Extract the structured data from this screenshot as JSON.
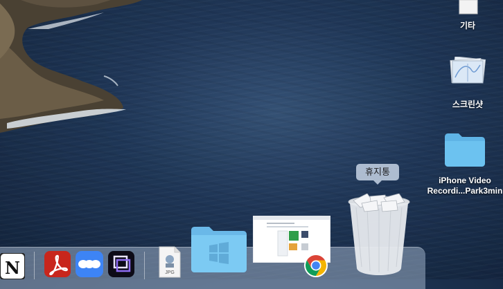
{
  "desktop": {
    "icons": [
      {
        "label": "기타"
      },
      {
        "label": "스크린샷"
      },
      {
        "label_line1": "iPhone Video",
        "label_line2": "Recordi...Park3min"
      }
    ]
  },
  "dock": {
    "apps": [
      {
        "name": "Notion",
        "icon": "notion-icon"
      },
      {
        "name": "Acrobat",
        "icon": "acrobat-icon"
      },
      {
        "name": "More",
        "icon": "more-dots-icon"
      },
      {
        "name": "Screen app",
        "icon": "overlap-squares-icon"
      },
      {
        "name": "JPG file",
        "icon": "jpg-file-icon",
        "badge": "JPG"
      },
      {
        "name": "Windows folder",
        "icon": "windows-folder-icon"
      },
      {
        "name": "Chrome window",
        "icon": "chrome-icon"
      },
      {
        "name": "Trash",
        "icon": "trash-icon"
      }
    ],
    "tooltip": "휴지통"
  },
  "colors": {
    "folder": "#6cbfea",
    "acrobat": "#c8261c",
    "more_blue": "#3d84f5"
  }
}
